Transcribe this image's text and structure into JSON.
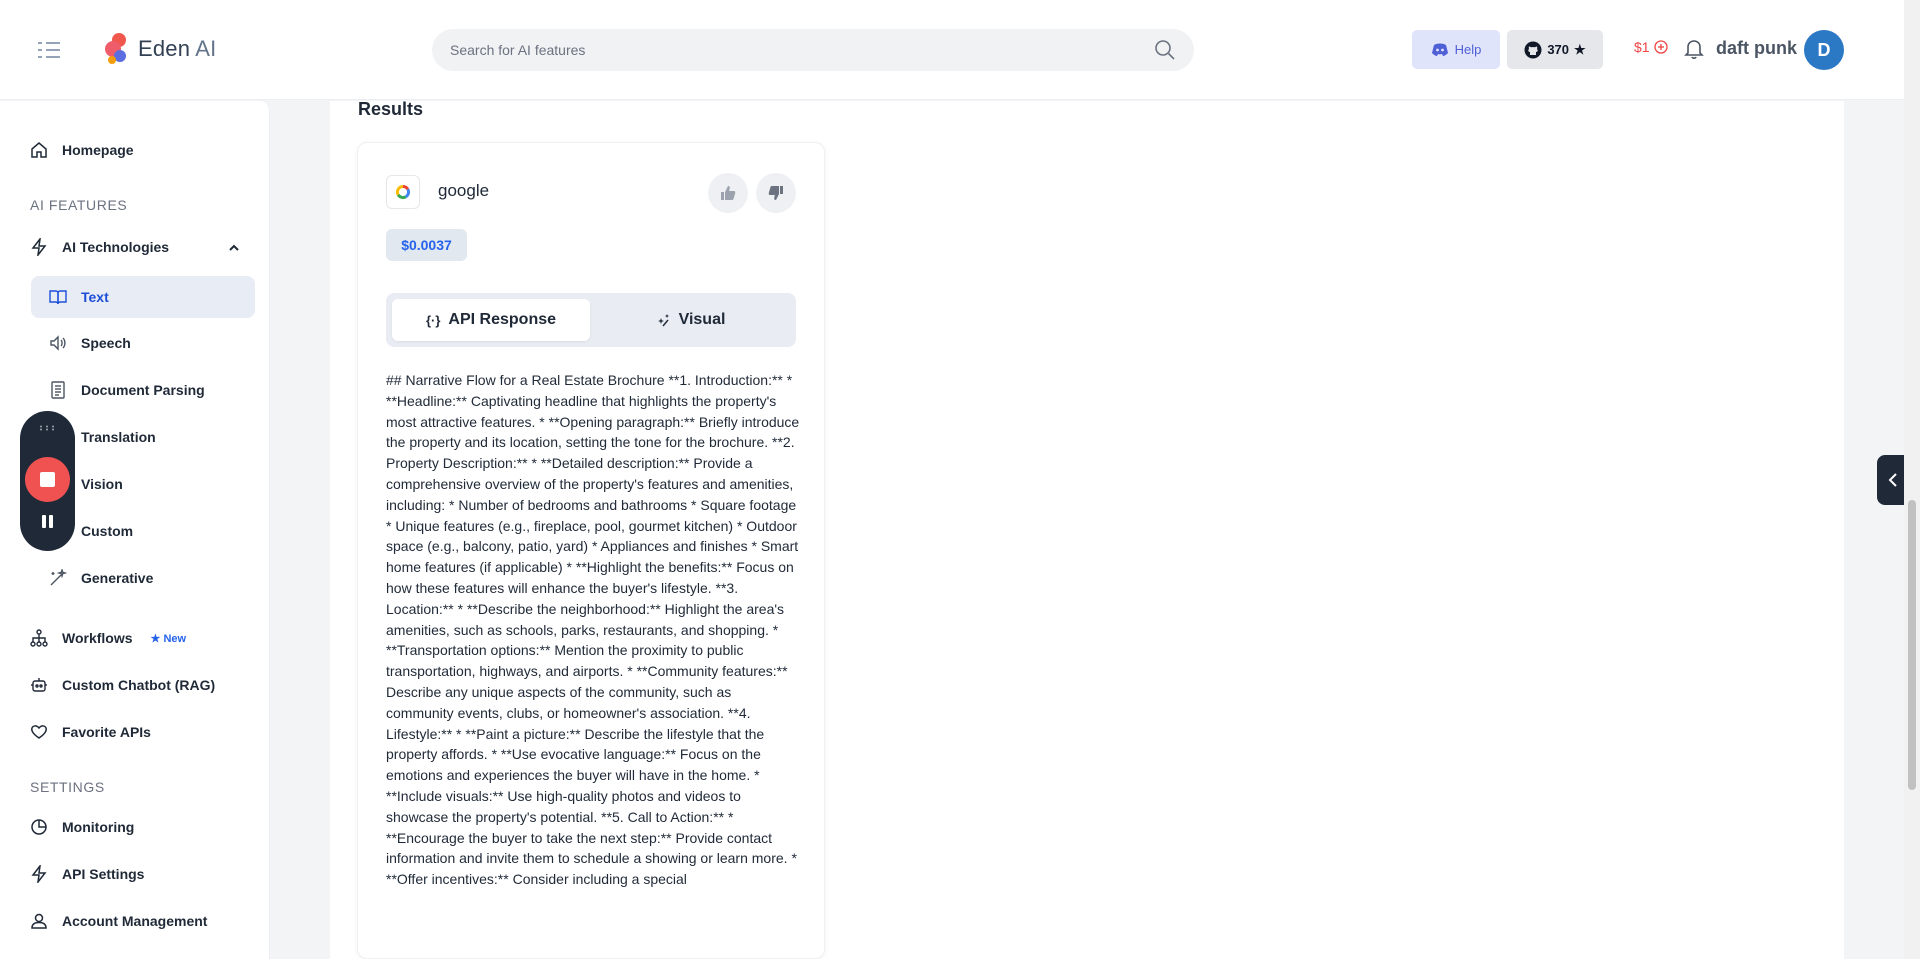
{
  "header": {
    "logo_text": "Eden",
    "logo_ai": "AI",
    "search_placeholder": "Search for AI features",
    "help_label": "Help",
    "github_count": "370",
    "credits": "$1",
    "user_name": "daft punk",
    "avatar_initial": "D"
  },
  "sidebar": {
    "homepage": "Homepage",
    "ai_features_title": "AI FEATURES",
    "ai_technologies": "AI Technologies",
    "sub_items": [
      "Text",
      "Speech",
      "Document Parsing",
      "Translation",
      "Vision",
      "Custom",
      "Generative"
    ],
    "workflows": "Workflows",
    "new_badge": "New",
    "custom_chatbot": "Custom Chatbot (RAG)",
    "favorite_apis": "Favorite APIs",
    "settings_title": "SETTINGS",
    "monitoring": "Monitoring",
    "api_settings": "API Settings",
    "account_management": "Account Management"
  },
  "main": {
    "results_title": "Results",
    "provider_name": "google",
    "price": "$0.0037",
    "tabs": [
      "API Response",
      "Visual"
    ],
    "response_text": "## Narrative Flow for a Real Estate Brochure **1. Introduction:** * **Headline:** Captivating headline that highlights the property's most attractive features. * **Opening paragraph:** Briefly introduce the property and its location, setting the tone for the brochure. **2. Property Description:** * **Detailed description:** Provide a comprehensive overview of the property's features and amenities, including: * Number of bedrooms and bathrooms * Square footage * Unique features (e.g., fireplace, pool, gourmet kitchen) * Outdoor space (e.g., balcony, patio, yard) * Appliances and finishes * Smart home features (if applicable) * **Highlight the benefits:** Focus on how these features will enhance the buyer's lifestyle. **3. Location:** * **Describe the neighborhood:** Highlight the area's amenities, such as schools, parks, restaurants, and shopping. * **Transportation options:** Mention the proximity to public transportation, highways, and airports. * **Community features:** Describe any unique aspects of the community, such as community events, clubs, or homeowner's association. **4. Lifestyle:** * **Paint a picture:** Describe the lifestyle that the property affords. * **Use evocative language:** Focus on the emotions and experiences the buyer will have in the home. * **Include visuals:** Use high-quality photos and videos to showcase the property's potential. **5. Call to Action:** * **Encourage the buyer to take the next step:** Provide contact information and invite them to schedule a showing or learn more. * **Offer incentives:** Consider including a special"
  },
  "colors": {
    "accent": "#2563eb",
    "recorder_bg": "#1f2937",
    "record_red": "#f05252"
  }
}
